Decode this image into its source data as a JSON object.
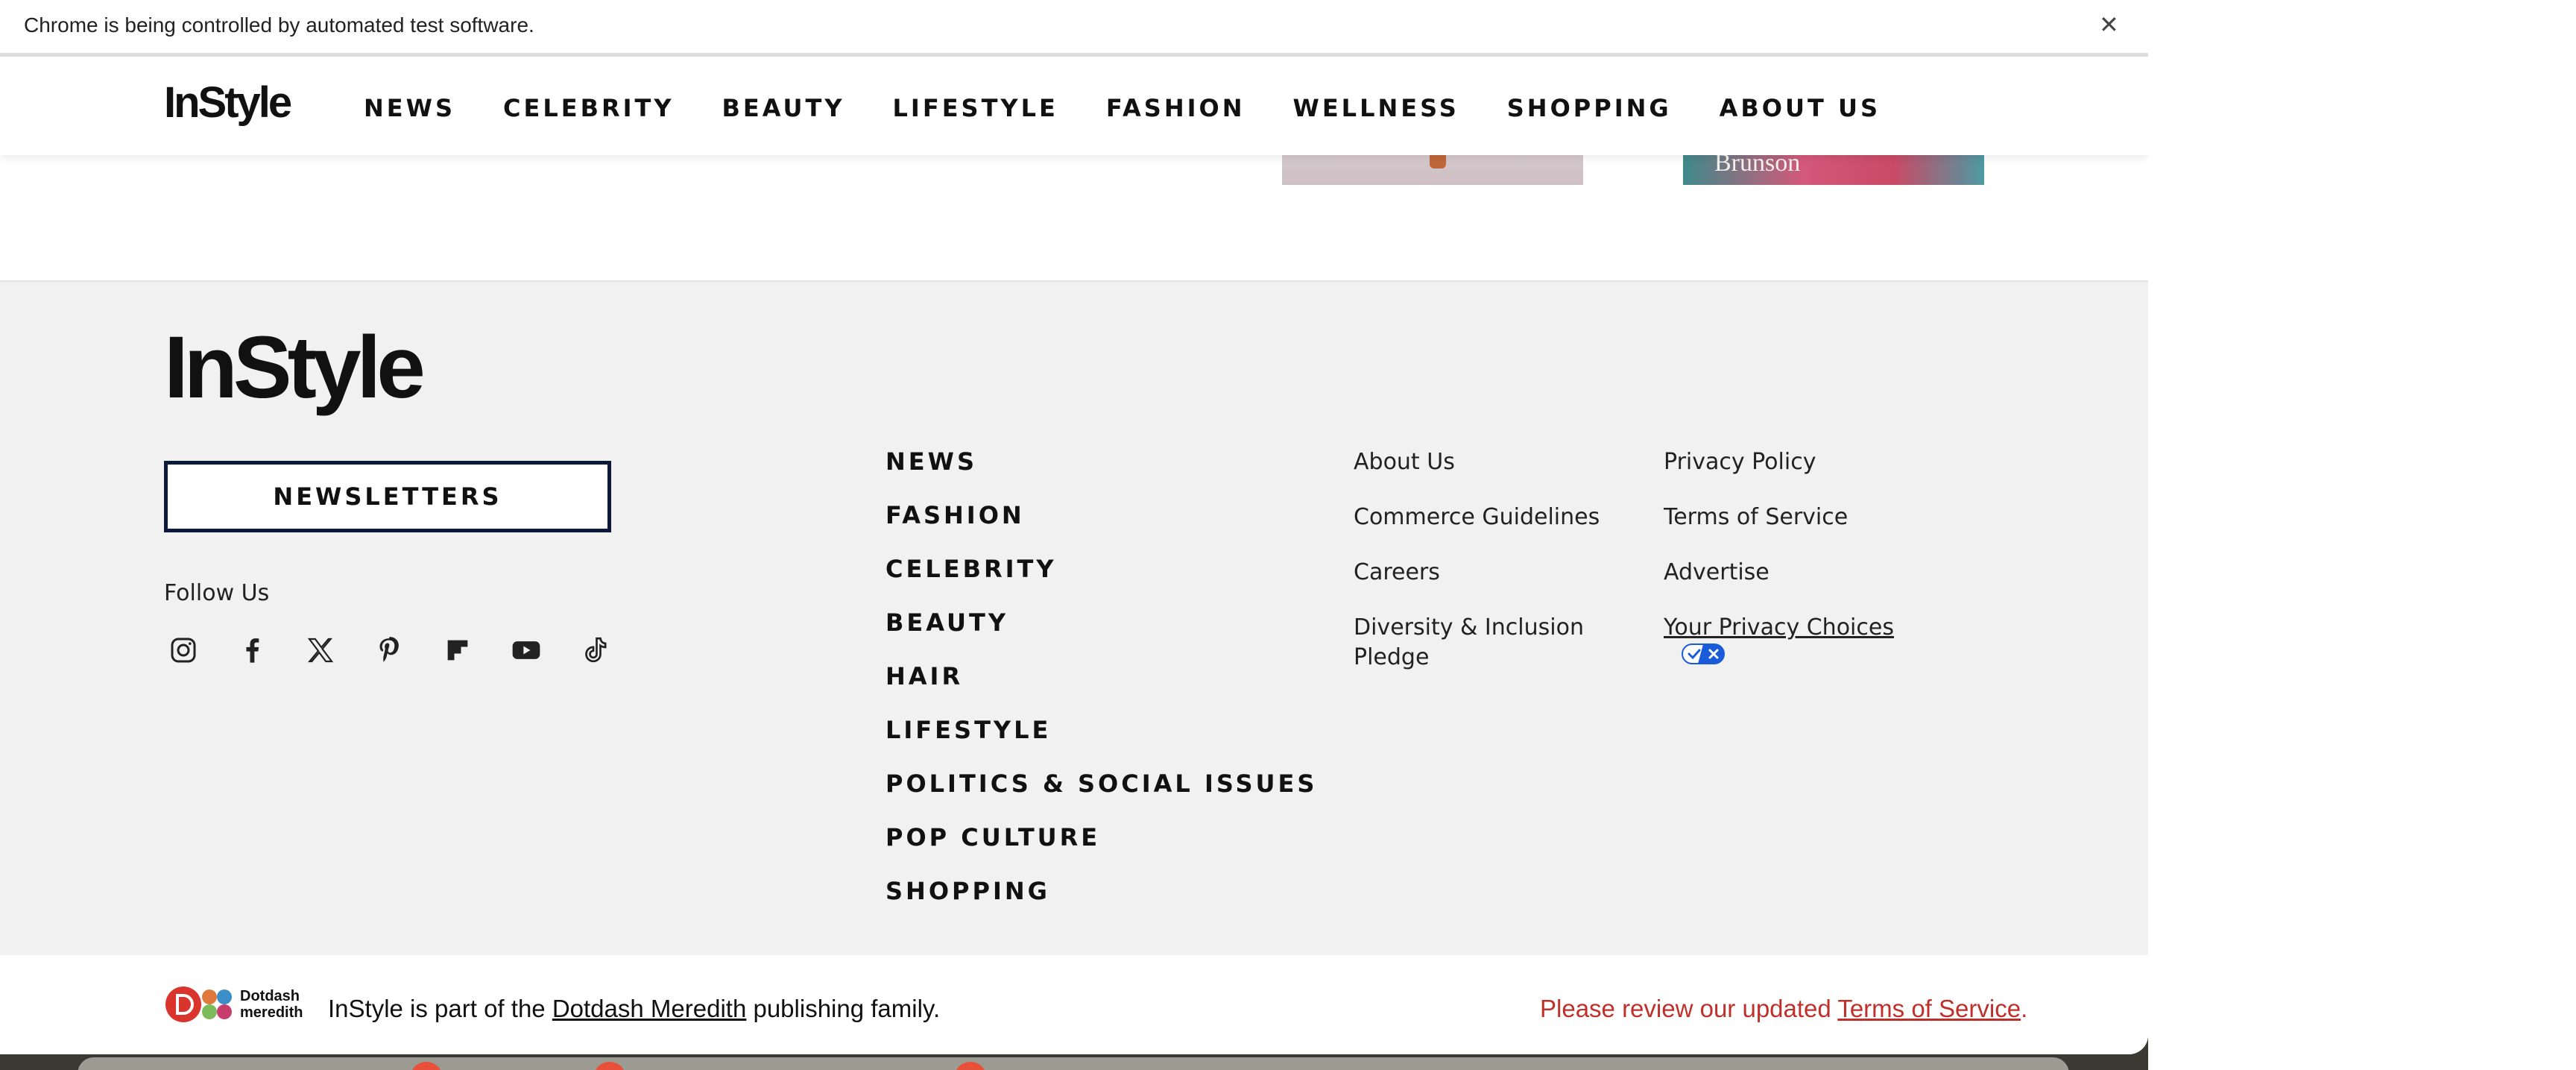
{
  "browser": {
    "automation_message": "Chrome is being controlled by automated test software.",
    "close_glyph": "✕"
  },
  "header": {
    "logo": "InStyle",
    "nav": [
      "NEWS",
      "CELEBRITY",
      "BEAUTY",
      "LIFESTYLE",
      "FASHION",
      "WELLNESS",
      "SHOPPING",
      "ABOUT US"
    ],
    "search_icon": "search-icon"
  },
  "teasers": {
    "second_caption": "Brunson"
  },
  "footer": {
    "logo": "InStyle",
    "newsletter_label": "NEWSLETTERS",
    "follow_label": "Follow Us",
    "social_icons": [
      "instagram-icon",
      "facebook-icon",
      "x-icon",
      "pinterest-icon",
      "flipboard-icon",
      "youtube-icon",
      "tiktok-icon"
    ],
    "categories": [
      "NEWS",
      "FASHION",
      "CELEBRITY",
      "BEAUTY",
      "HAIR",
      "LIFESTYLE",
      "POLITICS & SOCIAL ISSUES",
      "POP CULTURE",
      "SHOPPING"
    ],
    "links_col_a": [
      "About Us",
      "Commerce Guidelines",
      "Careers",
      "Diversity & Inclusion Pledge"
    ],
    "links_col_b": [
      "Privacy Policy",
      "Terms of Service",
      "Advertise"
    ],
    "privacy_choices_label": "Your Privacy Choices"
  },
  "bottom_bar": {
    "dd_logo_line1": "Dotdash",
    "dd_logo_line2": "meredith",
    "publish_prefix": "InStyle is part of the ",
    "publish_link": "Dotdash Meredith",
    "publish_suffix": " publishing family.",
    "tos_prefix": "Please review our updated ",
    "tos_link": "Terms of Service",
    "tos_suffix": "."
  },
  "colors": {
    "newsletter_border": "#0c1a3a",
    "tos_notice": "#c0302a",
    "footer_bg": "#f1f1f1"
  }
}
